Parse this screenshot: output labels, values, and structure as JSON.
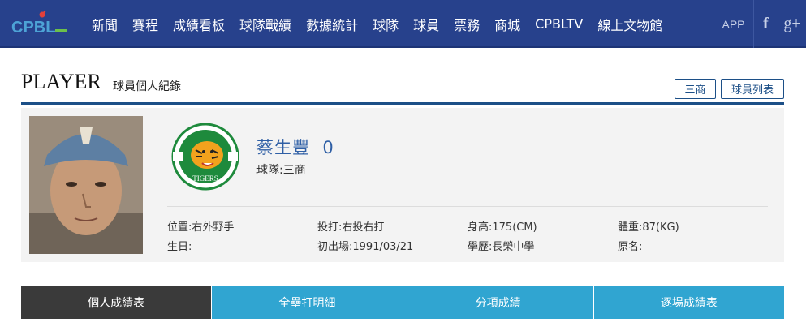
{
  "brand": {
    "logo_text": "CPBL"
  },
  "nav": {
    "items": [
      "新聞",
      "賽程",
      "成績看板",
      "球隊戰績",
      "數據統計",
      "球隊",
      "球員",
      "票務",
      "商城",
      "CPBLTV",
      "線上文物館"
    ],
    "app_label": "APP",
    "facebook_label": "f",
    "googleplus_label": "g+"
  },
  "page_header": {
    "title": "PLAYER",
    "subtitle": "球員個人紀錄",
    "team_button": "三商",
    "list_button": "球員列表"
  },
  "player": {
    "name": "蔡生豐",
    "number": "0",
    "team_line": "球隊:三商",
    "team_logo_text": "TIGERS",
    "fields": [
      [
        "位置:右外野手",
        "投打:右投右打",
        "身高:175(CM)",
        "體重:87(KG)"
      ],
      [
        "生日:",
        "初出場:1991/03/21",
        "學歷:長榮中學",
        "原名:"
      ]
    ]
  },
  "tabs": [
    {
      "label": "個人成績表",
      "active": true
    },
    {
      "label": "全壘打明細",
      "active": false
    },
    {
      "label": "分項成績",
      "active": false
    },
    {
      "label": "逐場成績表",
      "active": false
    }
  ],
  "colors": {
    "nav_bg": "#27418c",
    "accent": "#1c4f87",
    "tab_bg": "#30a5d1",
    "tab_active_bg": "#3a3a3a",
    "name_color": "#2f5fa5"
  }
}
